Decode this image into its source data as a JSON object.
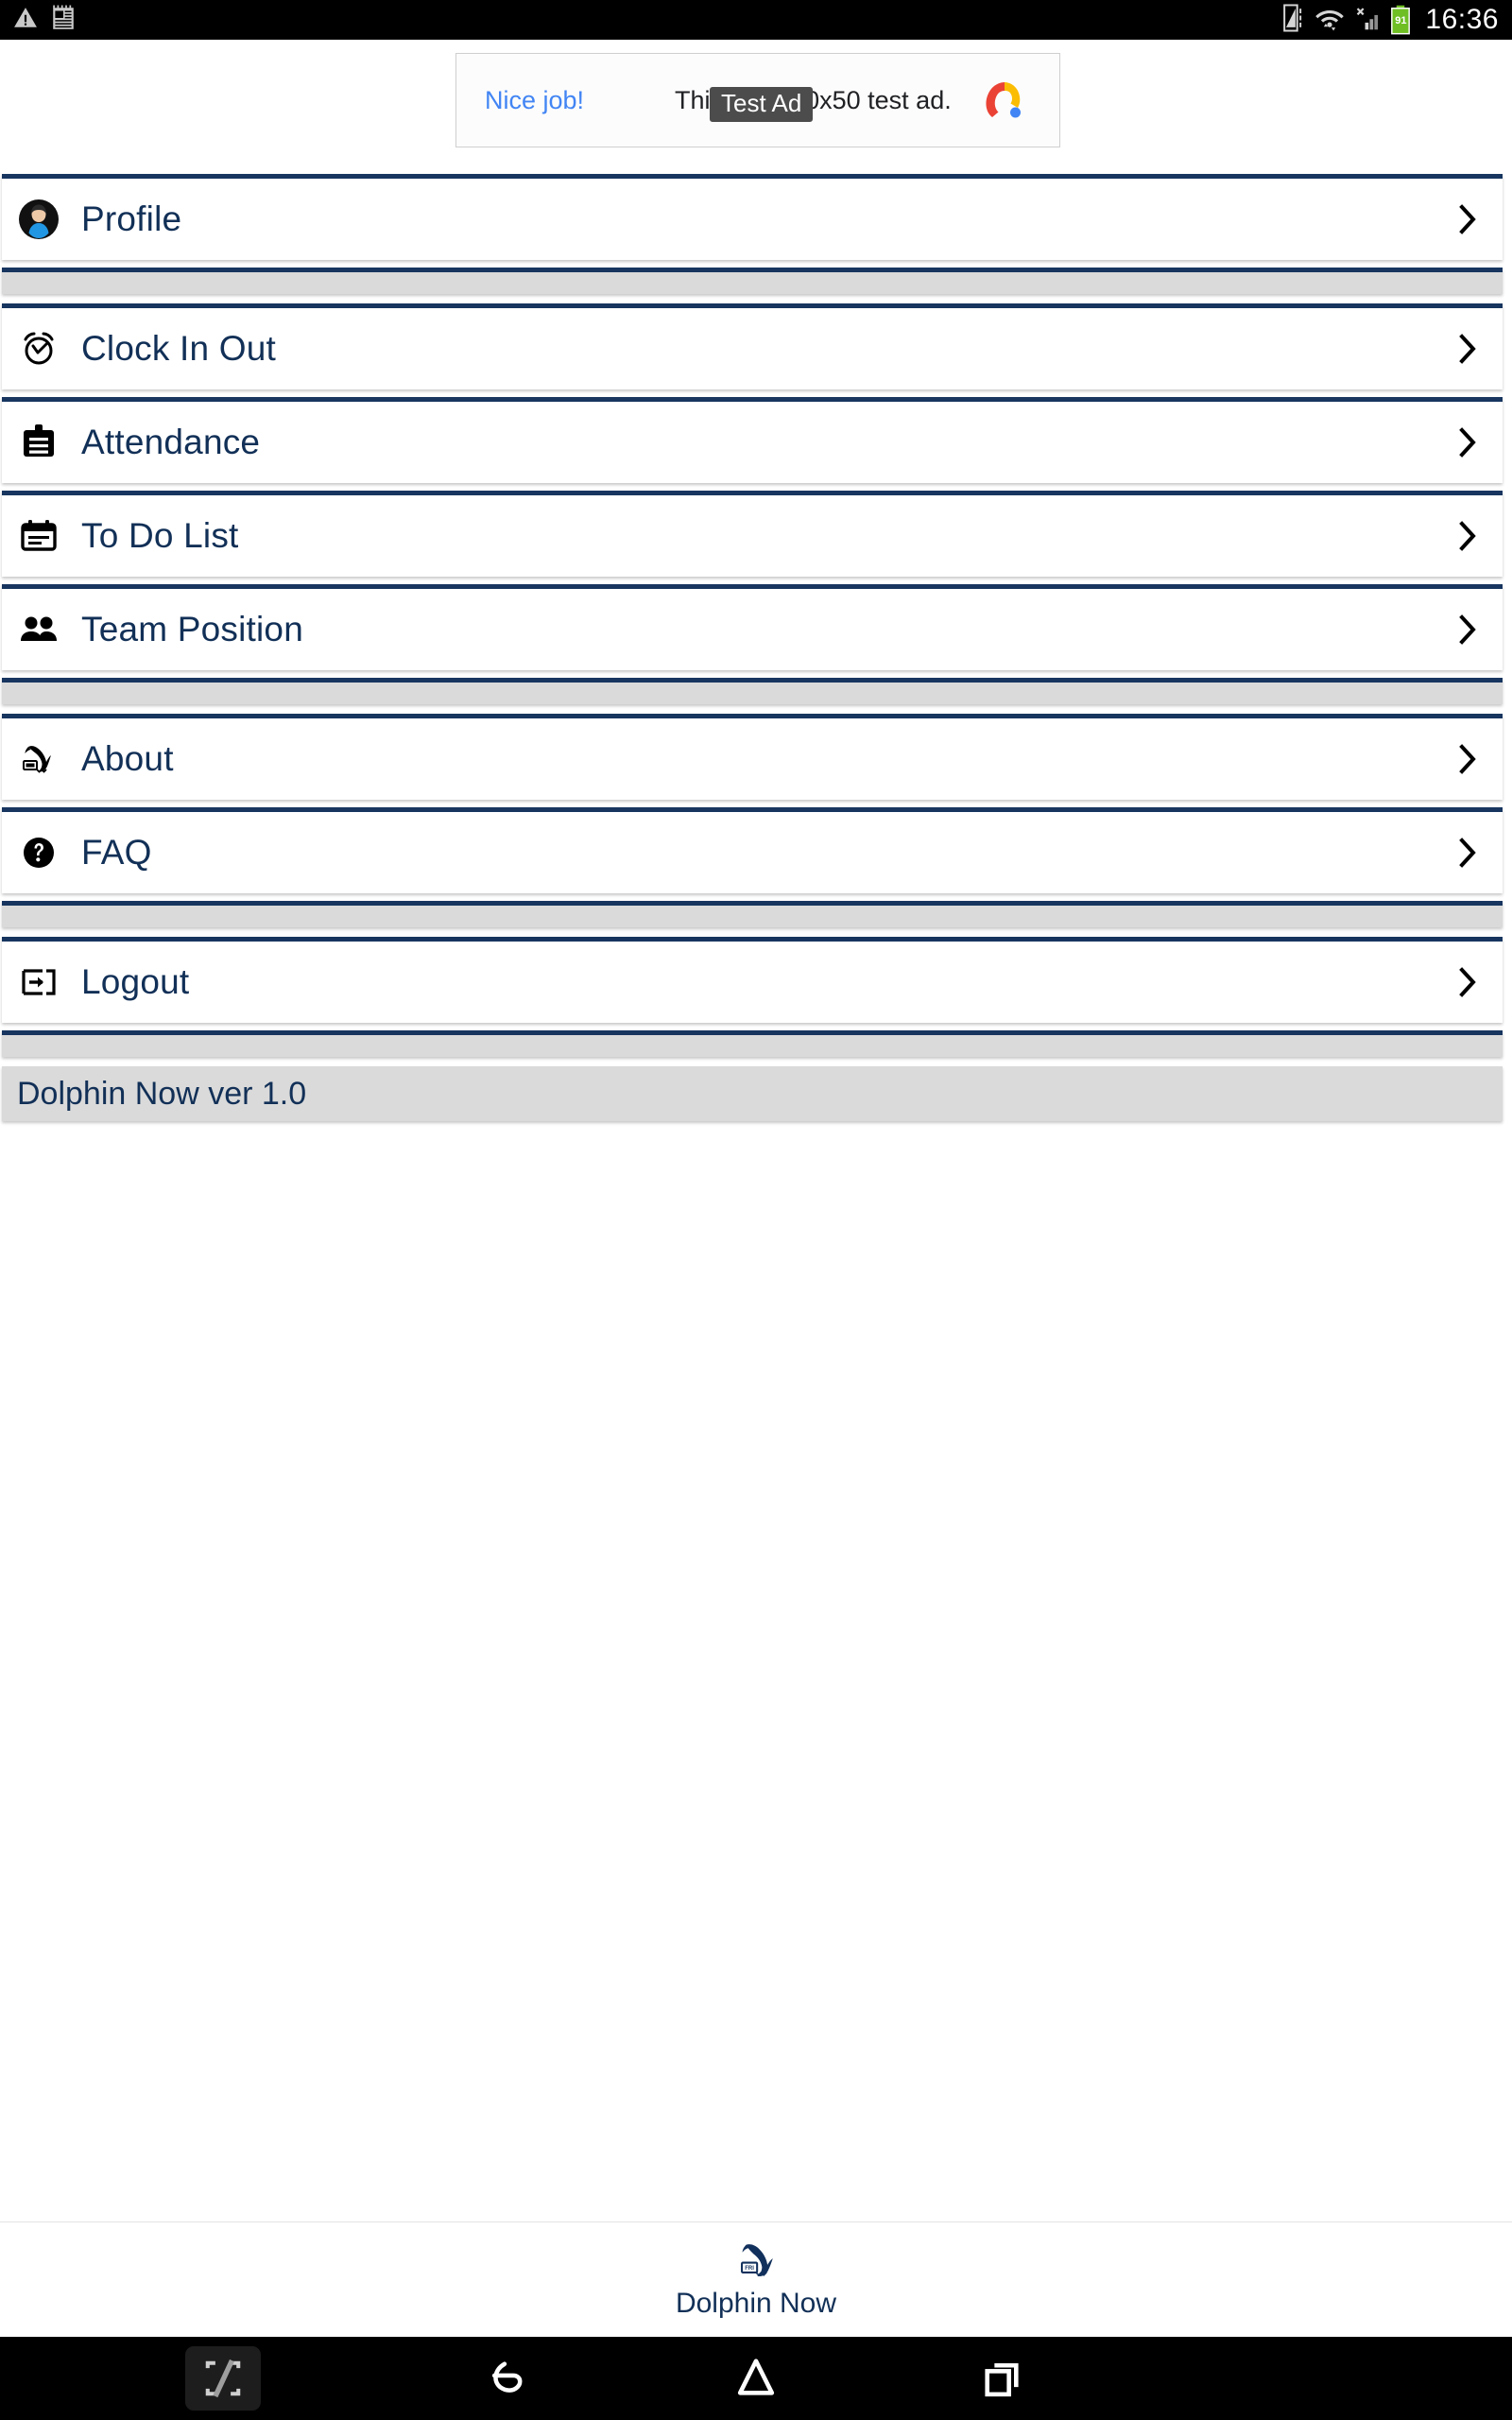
{
  "status_bar": {
    "time": "16:36",
    "battery_level": "91",
    "left_icons": [
      "warning-icon",
      "news-widget-icon"
    ],
    "right_icons": [
      "vibrate-icon",
      "wifi-icon",
      "cellular-no-sim-icon",
      "battery-icon"
    ]
  },
  "ad": {
    "tag": "Test Ad",
    "cta": "Nice job!",
    "body": "This is a 320x50 test ad.",
    "logo": "admob-logo-icon"
  },
  "menu": {
    "groups": [
      {
        "items": [
          {
            "label": "Profile",
            "icon": "avatar-icon",
            "chevron": "chevron-right-icon"
          }
        ]
      },
      {
        "items": [
          {
            "label": "Clock In Out",
            "icon": "alarm-check-icon",
            "chevron": "chevron-right-icon"
          },
          {
            "label": "Attendance",
            "icon": "clipboard-icon",
            "chevron": "chevron-right-icon"
          },
          {
            "label": "To Do List",
            "icon": "calendar-note-icon",
            "chevron": "chevron-right-icon"
          },
          {
            "label": "Team Position",
            "icon": "people-group-icon",
            "chevron": "chevron-right-icon"
          }
        ]
      },
      {
        "items": [
          {
            "label": "About",
            "icon": "dolphin-icon",
            "chevron": "chevron-right-icon"
          },
          {
            "label": "FAQ",
            "icon": "help-circle-icon",
            "chevron": "chevron-right-icon"
          }
        ]
      },
      {
        "items": [
          {
            "label": "Logout",
            "icon": "exit-icon",
            "chevron": "chevron-right-icon"
          }
        ]
      }
    ],
    "version": "Dolphin Now ver 1.0"
  },
  "tab_bar": {
    "label": "Dolphin Now",
    "icon": "dolphin-logo-icon"
  },
  "nav_bar": {
    "buttons": [
      "screenshot-button",
      "back-button",
      "home-button",
      "recents-button"
    ]
  },
  "colors": {
    "accent_navy": "#17355f",
    "text_navy": "#123057",
    "spacer_gray": "#dadada",
    "ad_link_blue": "#4285f4"
  }
}
